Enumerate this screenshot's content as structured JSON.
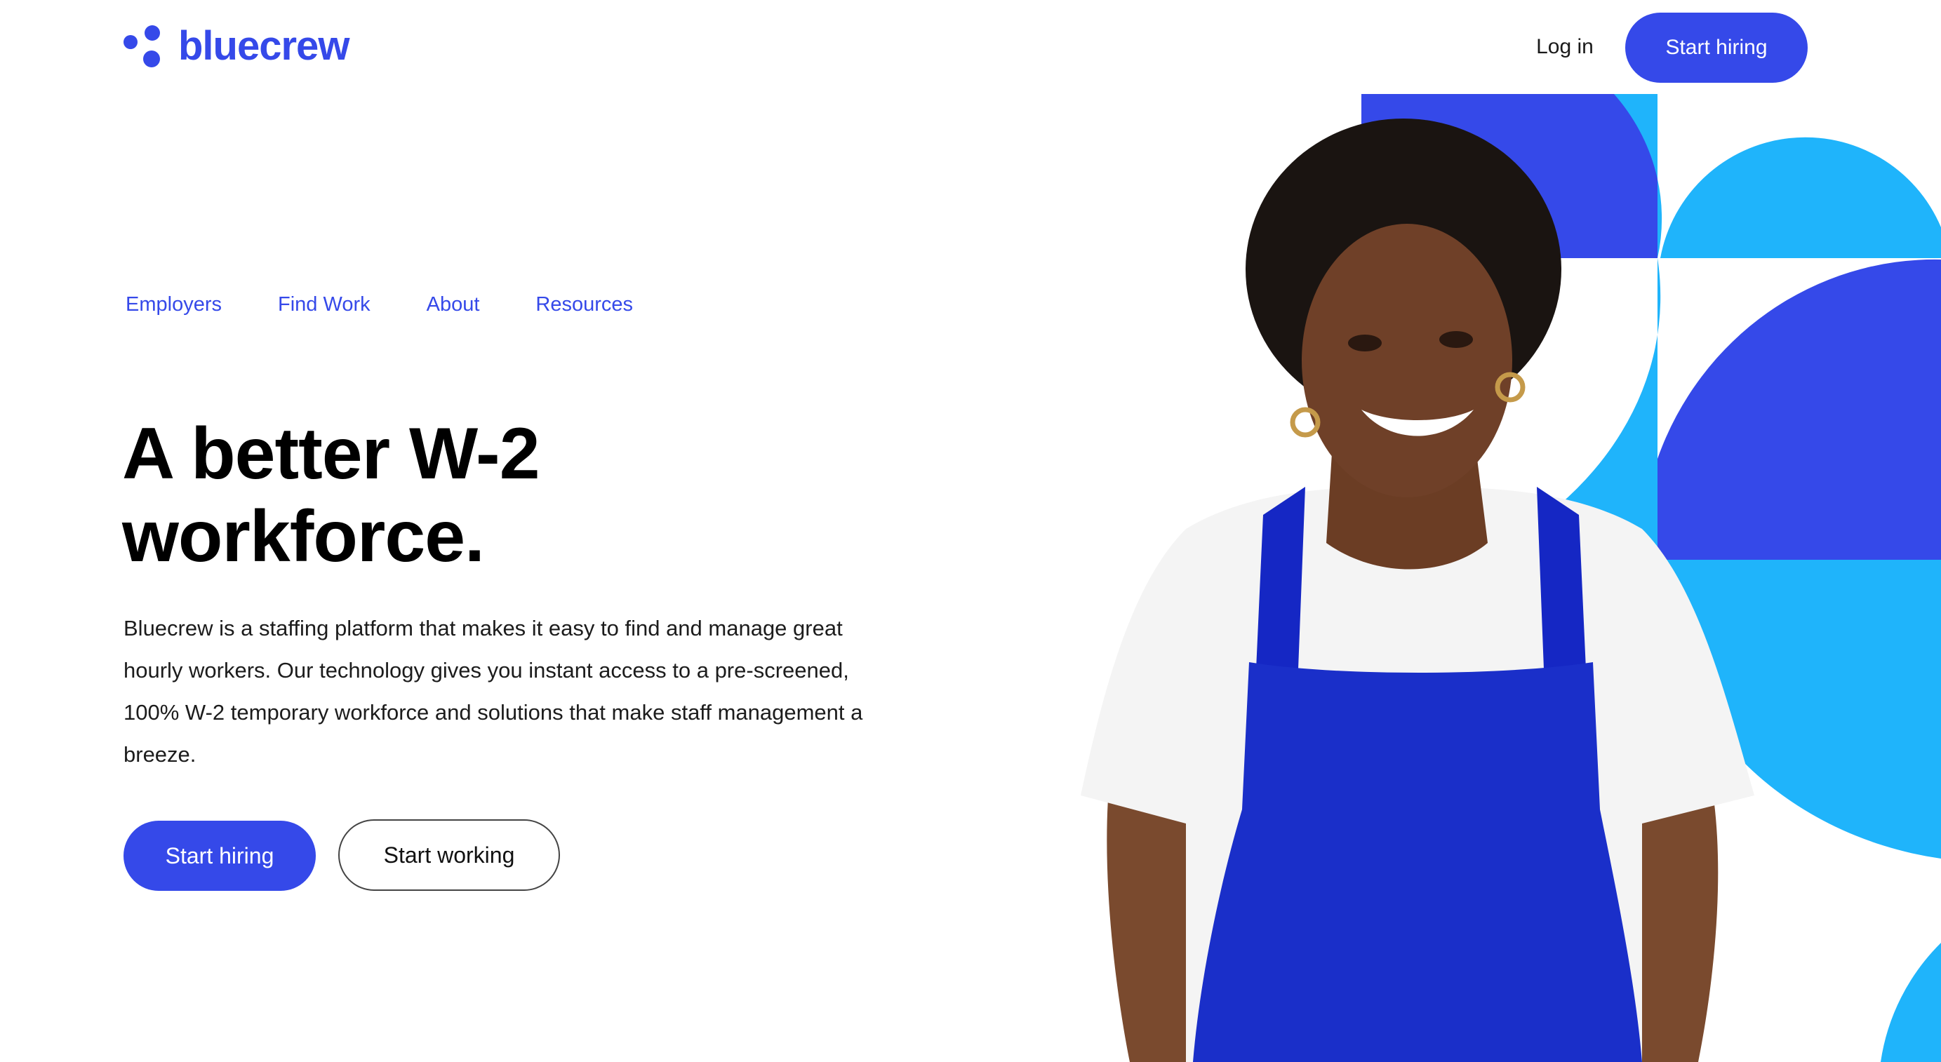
{
  "brand": {
    "name": "bluecrew",
    "primary_color": "#3549e9",
    "accent_color": "#1fb4fb",
    "deep_color": "#1527c4"
  },
  "header": {
    "login_label": "Log in",
    "cta_label": "Start hiring"
  },
  "nav": {
    "items": [
      {
        "label": "Employers"
      },
      {
        "label": "Find Work"
      },
      {
        "label": "About"
      },
      {
        "label": "Resources"
      }
    ]
  },
  "hero": {
    "headline_line1": "A better W-2",
    "headline_line2": "workforce.",
    "description": "Bluecrew is a staffing platform that makes it easy to find and manage great hourly workers. Our technology gives you instant access to a pre-screened, 100% W-2 temporary workforce and solutions that make staff management a breeze.",
    "primary_button": "Start hiring",
    "secondary_button": "Start working"
  }
}
